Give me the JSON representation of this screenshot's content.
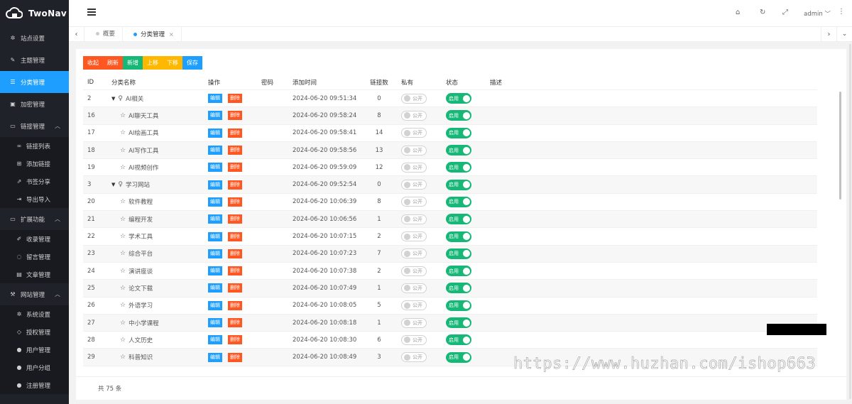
{
  "app": {
    "logo_text": "TwoNav"
  },
  "sidebar": {
    "items": [
      {
        "label": "站点设置",
        "icon": "gear-icon",
        "glyph": "✲"
      },
      {
        "label": "主题管理",
        "icon": "brush-icon",
        "glyph": "✎"
      },
      {
        "label": "分类管理",
        "icon": "list-icon",
        "glyph": "☰"
      },
      {
        "label": "加密管理",
        "icon": "lock-icon",
        "glyph": "▣"
      },
      {
        "label": "链接管理",
        "icon": "folder-icon",
        "glyph": "▭"
      },
      {
        "label": "链接列表",
        "icon": "link-icon",
        "glyph": "∞"
      },
      {
        "label": "添加链接",
        "icon": "add-box-icon",
        "glyph": "⊞"
      },
      {
        "label": "书签分享",
        "icon": "share-icon",
        "glyph": "⇗"
      },
      {
        "label": "导出导入",
        "icon": "sign-in-icon",
        "glyph": "⇥"
      },
      {
        "label": "扩展功能",
        "icon": "folder-icon",
        "glyph": "▭"
      },
      {
        "label": "收录管理",
        "icon": "pen-icon",
        "glyph": "✐"
      },
      {
        "label": "留言管理",
        "icon": "comment-icon",
        "glyph": "◌"
      },
      {
        "label": "文章管理",
        "icon": "document-icon",
        "glyph": "▤"
      },
      {
        "label": "网站管理",
        "icon": "wrench-icon",
        "glyph": "⚒"
      },
      {
        "label": "系统设置",
        "icon": "cogs-icon",
        "glyph": "✲"
      },
      {
        "label": "授权管理",
        "icon": "diamond-icon",
        "glyph": "◇"
      },
      {
        "label": "用户管理",
        "icon": "user-icon",
        "glyph": "●"
      },
      {
        "label": "用户分组",
        "icon": "users-icon",
        "glyph": "●"
      },
      {
        "label": "注册管理",
        "icon": "user-plus-icon",
        "glyph": "●"
      }
    ]
  },
  "header": {
    "user": "admin",
    "home_glyph": "⌂",
    "refresh_glyph": "↻",
    "fullscreen_glyph": "⤢",
    "menu_glyph": "⋮"
  },
  "tabs": [
    {
      "label": "概要"
    },
    {
      "label": "分类管理",
      "close": "×"
    }
  ],
  "toolbar": {
    "collapse": "收起",
    "refresh": "刷新",
    "add": "新增",
    "up": "上移",
    "down": "下移",
    "save": "保存"
  },
  "table": {
    "columns": {
      "id": "ID",
      "name": "分类名称",
      "ops": "操作",
      "pwd": "密码",
      "time": "添加时间",
      "count": "链接数",
      "priv": "私有",
      "status": "状态",
      "desc": "描述"
    },
    "edit_label": "编辑",
    "delete_label": "删除",
    "public_label": "公开",
    "enabled_label": "启用",
    "rows": [
      {
        "id": "2",
        "name": "AI相关",
        "parent": true,
        "time": "2024-06-20 09:51:34",
        "count": "0"
      },
      {
        "id": "16",
        "name": "AI聊天工具",
        "parent": false,
        "time": "2024-06-20 09:58:24",
        "count": "8"
      },
      {
        "id": "17",
        "name": "AI绘画工具",
        "parent": false,
        "time": "2024-06-20 09:58:41",
        "count": "14"
      },
      {
        "id": "18",
        "name": "AI写作工具",
        "parent": false,
        "time": "2024-06-20 09:58:56",
        "count": "13"
      },
      {
        "id": "19",
        "name": "AI视频创作",
        "parent": false,
        "time": "2024-06-20 09:59:09",
        "count": "12"
      },
      {
        "id": "3",
        "name": "学习网站",
        "parent": true,
        "time": "2024-06-20 09:52:54",
        "count": "0"
      },
      {
        "id": "20",
        "name": "软件教程",
        "parent": false,
        "time": "2024-06-20 10:06:39",
        "count": "8"
      },
      {
        "id": "21",
        "name": "编程开发",
        "parent": false,
        "time": "2024-06-20 10:06:56",
        "count": "1"
      },
      {
        "id": "22",
        "name": "学术工具",
        "parent": false,
        "time": "2024-06-20 10:07:15",
        "count": "2"
      },
      {
        "id": "23",
        "name": "综合平台",
        "parent": false,
        "time": "2024-06-20 10:07:23",
        "count": "7"
      },
      {
        "id": "24",
        "name": "演讲座谈",
        "parent": false,
        "time": "2024-06-20 10:07:38",
        "count": "2"
      },
      {
        "id": "25",
        "name": "论文下载",
        "parent": false,
        "time": "2024-06-20 10:07:49",
        "count": "1"
      },
      {
        "id": "26",
        "name": "外语学习",
        "parent": false,
        "time": "2024-06-20 10:08:05",
        "count": "5"
      },
      {
        "id": "27",
        "name": "中小学课程",
        "parent": false,
        "time": "2024-06-20 10:08:18",
        "count": "1"
      },
      {
        "id": "28",
        "name": "人文历史",
        "parent": false,
        "time": "2024-06-20 10:08:30",
        "count": "6"
      },
      {
        "id": "29",
        "name": "科普知识",
        "parent": false,
        "time": "2024-06-20 10:08:49",
        "count": "3"
      }
    ]
  },
  "footer": {
    "total": "共 75 条"
  },
  "watermark": "https://www.huzhan.com/ishop663",
  "colors": {
    "sidebar_bg": "#20222a",
    "accent": "#1e9fff",
    "danger": "#ff5722",
    "success": "#16b777",
    "warning": "#ffb800"
  }
}
